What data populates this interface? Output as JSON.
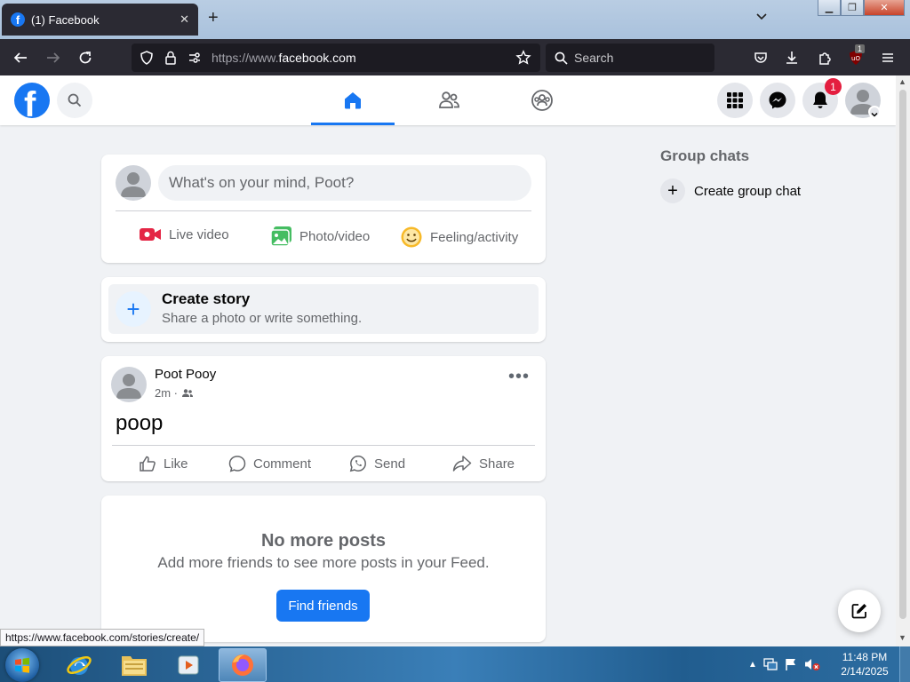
{
  "browser": {
    "tab_title": "(1) Facebook",
    "url_prefix": "https://www.",
    "url_domain": "facebook.com",
    "search_placeholder": "Search",
    "extension_badge": "1",
    "status_link": "https://www.facebook.com/stories/create/"
  },
  "fb": {
    "logo": "f",
    "notification_count": "1",
    "composer": {
      "placeholder": "What's on your mind, Poot?",
      "actions": [
        "Live video",
        "Photo/video",
        "Feeling/activity"
      ]
    },
    "story": {
      "title": "Create story",
      "subtitle": "Share a photo or write something."
    },
    "post": {
      "author": "Poot Pooy",
      "time": "2m ·",
      "body": "poop",
      "actions": [
        "Like",
        "Comment",
        "Send",
        "Share"
      ]
    },
    "end_of_feed": {
      "title": "No more posts",
      "subtitle": "Add more friends to see more posts in your Feed.",
      "button": "Find friends"
    },
    "sidebar": {
      "title": "Group chats",
      "create_label": "Create group chat"
    }
  },
  "taskbar": {
    "time": "11:48 PM",
    "date": "2/14/2025"
  },
  "colors": {
    "fb_blue": "#1877f2",
    "badge_red": "#e41e3f",
    "feed_bg": "#f0f2f5",
    "browser_dark": "#2b2a33"
  }
}
